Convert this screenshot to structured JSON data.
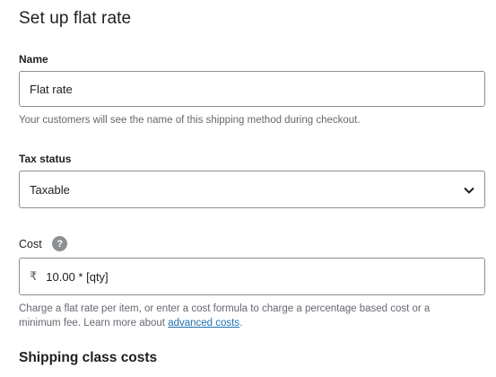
{
  "page": {
    "title": "Set up flat rate"
  },
  "name_field": {
    "label": "Name",
    "value": "Flat rate",
    "help": "Your customers will see the name of this shipping method during checkout."
  },
  "tax_field": {
    "label": "Tax status",
    "value": "Taxable",
    "icon": "chevron-down-icon"
  },
  "cost_field": {
    "label": "Cost",
    "help_icon": "?",
    "currency_symbol": "₹",
    "value": "10.00 * [qty]",
    "help_text": "Charge a flat rate per item, or enter a cost formula to charge a percentage based cost or a minimum fee. Learn more about ",
    "help_link": "advanced costs",
    "help_suffix": "."
  },
  "shipping_class": {
    "title": "Shipping class costs"
  },
  "colors": {
    "link": "#2271b1",
    "border": "#8c8f94",
    "help_text": "#646970"
  }
}
